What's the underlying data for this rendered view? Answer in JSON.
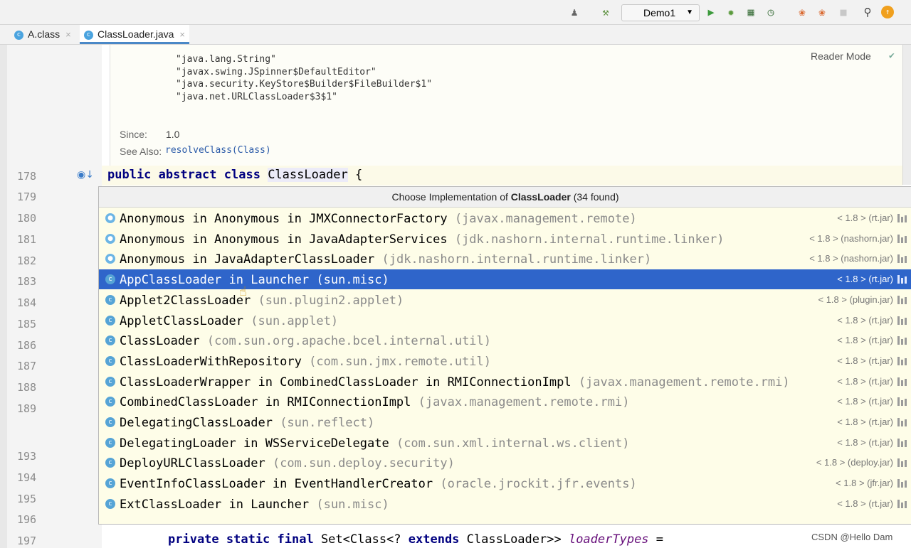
{
  "toolbar": {
    "run_config": "Demo1",
    "icons": [
      "user-icon",
      "build-hammer-icon",
      "run-icon",
      "debug-icon",
      "coverage-icon",
      "profile-icon",
      "gradle-icon",
      "stop-icon",
      "search-icon",
      "update-icon"
    ]
  },
  "tabs": [
    {
      "label": "A.class"
    },
    {
      "label": "ClassLoader.java"
    }
  ],
  "doc": {
    "lines": [
      "\"java.lang.String\"",
      "\"javax.swing.JSpinner$DefaultEditor\"",
      "\"java.security.KeyStore$Builder$FileBuilder$1\"",
      "\"java.net.URLClassLoader$3$1\""
    ],
    "since_label": "Since:",
    "since_value": "1.0",
    "see_also_label": "See Also:",
    "see_also_value": "resolveClass(Class)",
    "reader_mode": "Reader Mode"
  },
  "line_numbers": [
    "178",
    "179",
    "180",
    "181",
    "182",
    "183",
    "184",
    "185",
    "186",
    "187",
    "188",
    "189",
    "193",
    "194",
    "195",
    "196",
    "197"
  ],
  "code": {
    "class_kw": "public abstract class",
    "class_name": "ClassLoader",
    "class_brace": " {",
    "bottom_kw": "private static final",
    "bottom_type": " Set<Class<? ",
    "bottom_extends": "extends",
    "bottom_rest": " ClassLoader>> ",
    "bottom_field": "loaderTypes",
    "bottom_eq": " ="
  },
  "popup": {
    "title_prefix": "Choose Implementation of ",
    "title_class": "ClassLoader",
    "title_count": " (34 found)",
    "items": [
      {
        "name": "Anonymous in Anonymous in JMXConnectorFactory",
        "pkg": "(javax.management.remote)",
        "jar": "< 1.8 > (rt.jar)",
        "icon": "anon"
      },
      {
        "name": "Anonymous in Anonymous in JavaAdapterServices",
        "pkg": "(jdk.nashorn.internal.runtime.linker)",
        "jar": "< 1.8 > (nashorn.jar)",
        "icon": "anon"
      },
      {
        "name": "Anonymous in JavaAdapterClassLoader",
        "pkg": "(jdk.nashorn.internal.runtime.linker)",
        "jar": "< 1.8 > (nashorn.jar)",
        "icon": "anon"
      },
      {
        "name": "AppClassLoader in Launcher",
        "pkg": "(sun.misc)",
        "jar": "< 1.8 > (rt.jar)",
        "icon": "class",
        "selected": true
      },
      {
        "name": "Applet2ClassLoader",
        "pkg": "(sun.plugin2.applet)",
        "jar": "< 1.8 > (plugin.jar)",
        "icon": "class"
      },
      {
        "name": "AppletClassLoader",
        "pkg": "(sun.applet)",
        "jar": "< 1.8 > (rt.jar)",
        "icon": "class"
      },
      {
        "name": "ClassLoader",
        "pkg": "(com.sun.org.apache.bcel.internal.util)",
        "jar": "< 1.8 > (rt.jar)",
        "icon": "class"
      },
      {
        "name": "ClassLoaderWithRepository",
        "pkg": "(com.sun.jmx.remote.util)",
        "jar": "< 1.8 > (rt.jar)",
        "icon": "class"
      },
      {
        "name": "ClassLoaderWrapper in CombinedClassLoader in RMIConnectionImpl",
        "pkg": "(javax.management.remote.rmi)",
        "jar": "< 1.8 > (rt.jar)",
        "icon": "class"
      },
      {
        "name": "CombinedClassLoader in RMIConnectionImpl",
        "pkg": "(javax.management.remote.rmi)",
        "jar": "< 1.8 > (rt.jar)",
        "icon": "class"
      },
      {
        "name": "DelegatingClassLoader",
        "pkg": "(sun.reflect)",
        "jar": "< 1.8 > (rt.jar)",
        "icon": "class"
      },
      {
        "name": "DelegatingLoader in WSServiceDelegate",
        "pkg": "(com.sun.xml.internal.ws.client)",
        "jar": "< 1.8 > (rt.jar)",
        "icon": "class"
      },
      {
        "name": "DeployURLClassLoader",
        "pkg": "(com.sun.deploy.security)",
        "jar": "< 1.8 > (deploy.jar)",
        "icon": "class"
      },
      {
        "name": "EventInfoClassLoader in EventHandlerCreator",
        "pkg": "(oracle.jrockit.jfr.events)",
        "jar": "< 1.8 > (jfr.jar)",
        "icon": "class"
      },
      {
        "name": "ExtClassLoader in Launcher",
        "pkg": "(sun.misc)",
        "jar": "< 1.8 > (rt.jar)",
        "icon": "class"
      }
    ]
  },
  "watermark": "CSDN @Hello Dam"
}
